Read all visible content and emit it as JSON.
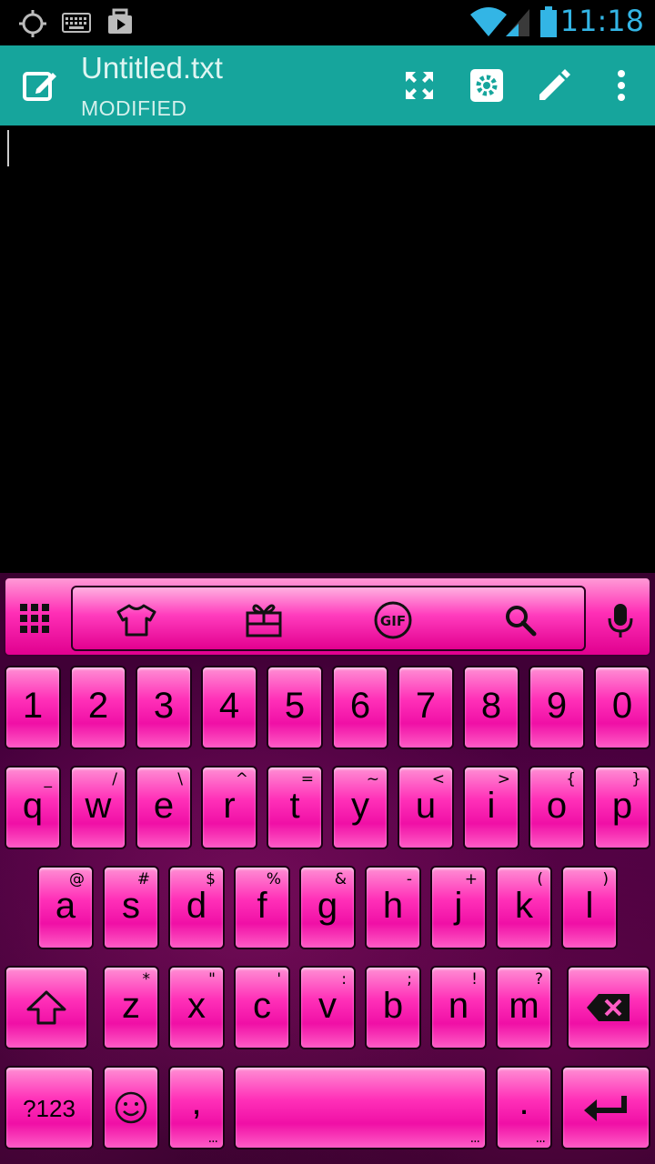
{
  "status_bar": {
    "time": "11:18",
    "icons": [
      "gps-icon",
      "keyboard-icon",
      "media-icon",
      "wifi-icon",
      "signal-icon",
      "battery-icon"
    ]
  },
  "app_bar": {
    "title": "Untitled.txt",
    "subtitle": "MODIFIED",
    "actions": [
      "fullscreen-icon",
      "settings-icon",
      "pencil-icon",
      "more-icon"
    ]
  },
  "editor": {
    "content": ""
  },
  "keyboard": {
    "toolbar": [
      "apps-grid-icon",
      "theme-shirt-icon",
      "gift-icon",
      "gif-icon",
      "search-icon",
      "microphone-icon"
    ],
    "toolbar_gif_label": "GIF",
    "rows": {
      "numbers": [
        {
          "main": "1"
        },
        {
          "main": "2"
        },
        {
          "main": "3"
        },
        {
          "main": "4"
        },
        {
          "main": "5"
        },
        {
          "main": "6"
        },
        {
          "main": "7"
        },
        {
          "main": "8"
        },
        {
          "main": "9"
        },
        {
          "main": "0"
        }
      ],
      "top": [
        {
          "main": "q",
          "hint": "_"
        },
        {
          "main": "w",
          "hint": "/"
        },
        {
          "main": "e",
          "hint": "\\"
        },
        {
          "main": "r",
          "hint": "^"
        },
        {
          "main": "t",
          "hint": "="
        },
        {
          "main": "y",
          "hint": "~"
        },
        {
          "main": "u",
          "hint": "<"
        },
        {
          "main": "i",
          "hint": ">"
        },
        {
          "main": "o",
          "hint": "{"
        },
        {
          "main": "p",
          "hint": "}"
        }
      ],
      "middle": [
        {
          "main": "a",
          "hint": "@"
        },
        {
          "main": "s",
          "hint": "#"
        },
        {
          "main": "d",
          "hint": "$"
        },
        {
          "main": "f",
          "hint": "%"
        },
        {
          "main": "g",
          "hint": "&"
        },
        {
          "main": "h",
          "hint": "-"
        },
        {
          "main": "j",
          "hint": "+"
        },
        {
          "main": "k",
          "hint": "("
        },
        {
          "main": "l",
          "hint": ")"
        }
      ],
      "bottom": [
        {
          "main": "z",
          "hint": "*"
        },
        {
          "main": "x",
          "hint": "\""
        },
        {
          "main": "c",
          "hint": "'"
        },
        {
          "main": "v",
          "hint": ":"
        },
        {
          "main": "b",
          "hint": ";"
        },
        {
          "main": "n",
          "hint": "!"
        },
        {
          "main": "m",
          "hint": "?"
        }
      ]
    },
    "symbols_label": "?123",
    "comma_label": ",",
    "period_label": ".",
    "more_dots": "...",
    "colors": {
      "key": "#ff30b8",
      "key_border": "#1a0014",
      "background": "#3a0030",
      "app_bar": "#16a59c",
      "status_accent": "#33b5e5"
    }
  }
}
